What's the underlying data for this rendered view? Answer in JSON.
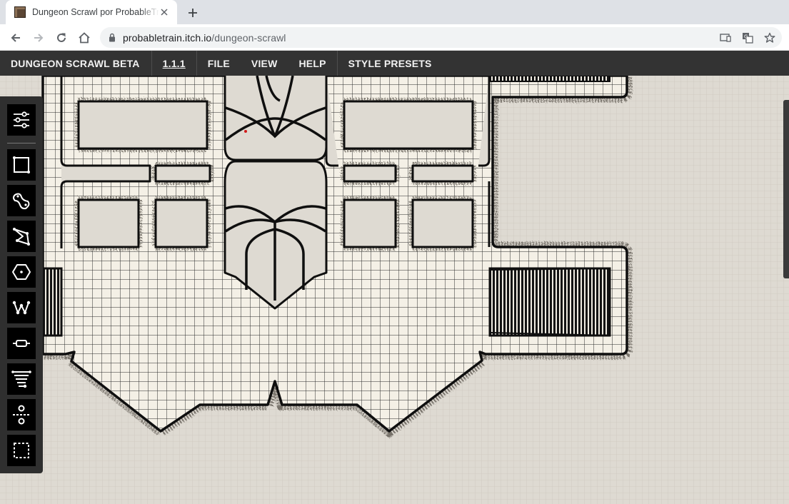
{
  "browser": {
    "tab_title": "Dungeon Scrawl por ProbableTrain",
    "url_domain": "probabletrain.itch.io",
    "url_path": "/dungeon-scrawl",
    "icons": [
      "back-icon",
      "forward-icon",
      "reload-icon",
      "home-icon",
      "lock-icon",
      "cast-icon",
      "translate-icon",
      "star-icon",
      "close-icon",
      "plus-icon"
    ]
  },
  "menu": {
    "brand": "DUNGEON SCRAWL BETA",
    "version": "1.1.1",
    "file": "FILE",
    "view": "VIEW",
    "help": "HELP",
    "style_presets": "STYLE PRESETS"
  },
  "tools": [
    {
      "name": "settings-sliders-icon"
    },
    {
      "name": "rectangle-tool-icon"
    },
    {
      "name": "freeform-tool-icon"
    },
    {
      "name": "polygon-tool-icon"
    },
    {
      "name": "hexagon-tool-icon"
    },
    {
      "name": "tree-tool-icon"
    },
    {
      "name": "door-tool-icon"
    },
    {
      "name": "stairs-tool-icon"
    },
    {
      "name": "divide-tool-icon"
    },
    {
      "name": "select-tool-icon"
    }
  ],
  "colors": {
    "menu_bar": "#333333",
    "tool_panel": "#2f2f2f",
    "parchment": "#dedad2",
    "floor": "#f4f0e6",
    "wall": "#111111",
    "hatch": "#6d6760"
  }
}
